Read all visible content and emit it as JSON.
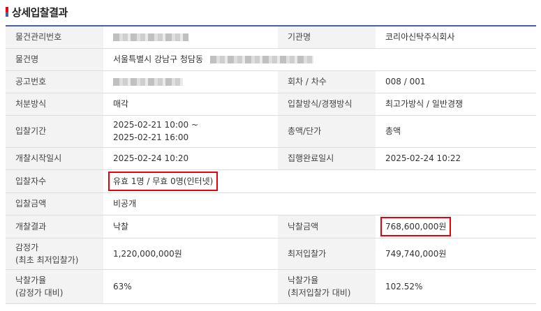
{
  "section_title": "상세입찰결과",
  "colors": {
    "accent_blue": "#4a5ea8",
    "marker_red": "#e8000b",
    "highlight_red": "#e8000b"
  },
  "rows": [
    {
      "label1": "물건관리번호",
      "value1": "",
      "label2": "기관명",
      "value2": "코리아신탁주식회사"
    },
    {
      "label1": "물건명",
      "value1": "서울특별시 강남구 청담동"
    },
    {
      "label1": "공고번호",
      "value1": "",
      "label2": "회차 / 차수",
      "value2": "008 / 001"
    },
    {
      "label1": "처분방식",
      "value1": "매각",
      "label2": "입찰방식/경쟁방식",
      "value2": "최고가방식 / 일반경쟁"
    },
    {
      "label1": "입찰기간",
      "value1_line1": "2025-02-21 10:00 ~",
      "value1_line2": "2025-02-21 16:00",
      "label2": "총액/단가",
      "value2": "총액"
    },
    {
      "label1": "개찰시작일시",
      "value1": "2025-02-24 10:20",
      "label2": "집행완료일시",
      "value2": "2025-02-24 10:22"
    },
    {
      "label1": "입찰자수",
      "value1": "유효 1명 / 무효 0명(인터넷)"
    },
    {
      "label1": "입찰금액",
      "value1": "비공개"
    },
    {
      "label1": "개찰결과",
      "value1": "낙찰",
      "label2": "낙찰금액",
      "value2": "768,600,000원"
    },
    {
      "label1_line1": "감정가",
      "label1_line2": "(최초 최저입찰가)",
      "value1": "1,220,000,000원",
      "label2": "최저입찰가",
      "value2": "749,740,000원"
    },
    {
      "label1_line1": "낙찰가율",
      "label1_line2": "(감정가 대비)",
      "value1": "63%",
      "label2_line1": "낙찰가율",
      "label2_line2": "(최저입찰가 대비)",
      "value2": "102.52%"
    }
  ]
}
